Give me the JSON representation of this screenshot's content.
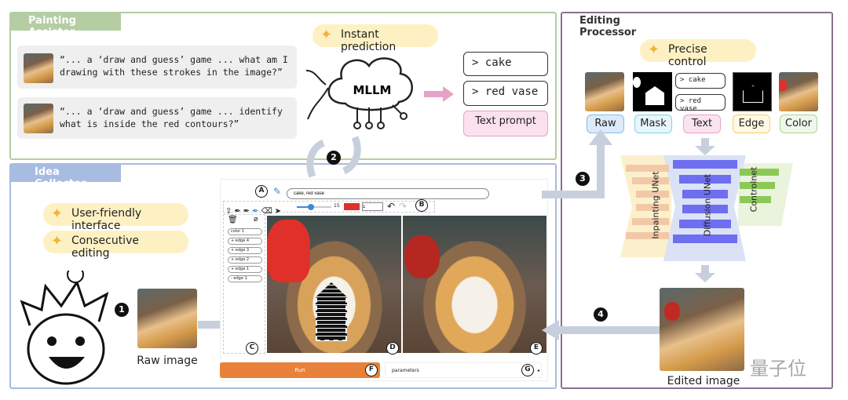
{
  "painting_assistor": {
    "title": "Painting Assistor",
    "queries": [
      "“... a ‘draw and guess’ game ... what am I drawing with these strokes in the image?”",
      "“... a ‘draw and guess’ game ... identify what is inside the red contours?”"
    ],
    "badge": "Instant prediction",
    "mllm_label": "MLLM",
    "outputs": [
      "> cake",
      "> red vase"
    ],
    "text_prompt": "Text prompt"
  },
  "editing_processor": {
    "title": "Editing Processor",
    "badge": "Precise control",
    "text_items": [
      "> cake",
      "> red vase"
    ],
    "condition_labels": [
      "Raw",
      "Mask",
      "Text",
      "Edge",
      "Color"
    ],
    "networks": [
      "Inpainting UNet",
      "Diffusion UNet",
      "Controlnet"
    ],
    "edited_label": "Edited image"
  },
  "idea_collector": {
    "title": "Idea Collector",
    "badges": [
      "User-friendly interface",
      "Consecutive editing"
    ],
    "raw_label": "Raw image",
    "ui": {
      "prompt_value": "cake, red vase",
      "brush_size": "15",
      "layer_value": "1",
      "layers": [
        "color 1",
        "+ edge 4",
        "+ edge 3",
        "+ edge 2",
        "+ edge 1",
        "- edge 1"
      ],
      "run_label": "Run",
      "parameters_label": "parameters",
      "markers": [
        "A",
        "B",
        "C",
        "D",
        "E",
        "F",
        "G"
      ],
      "brush_color": "#e0302a",
      "run_color": "#e8823a"
    }
  },
  "steps": [
    "1",
    "2",
    "3",
    "4"
  ],
  "watermark": "量子位",
  "colors": {
    "assistor": "#b5cda3",
    "collector": "#a8bbe0",
    "processor": "#8a7090"
  }
}
